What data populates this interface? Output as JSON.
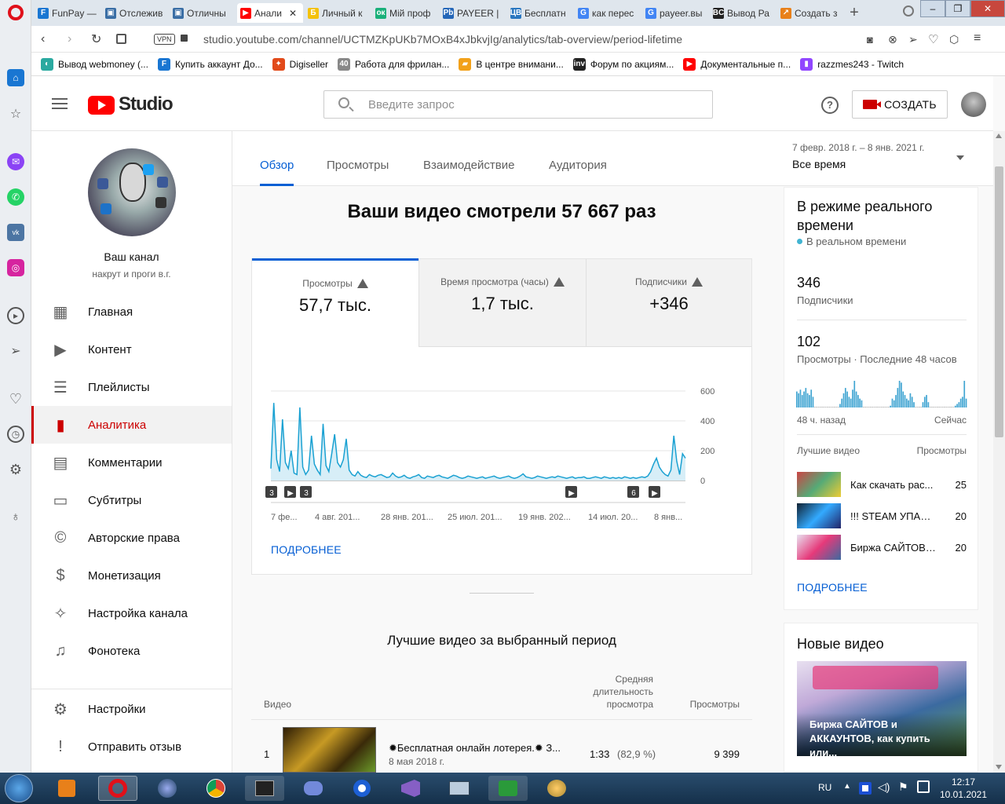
{
  "browser": {
    "tabs": [
      "FunPay —",
      "Отслежив",
      "Отличны",
      "Анали",
      "Личный к",
      "Мій проф",
      "PAYEER |",
      "Бесплатн",
      "как перес",
      "payeer.вы",
      "Вывод Ра",
      "Создать з"
    ],
    "url": "studio.youtube.com/channel/UCTMZKpUKb7MOxB4xJbkvjIg/analytics/tab-overview/period-lifetime",
    "vpn": "VPN",
    "bookmarks": [
      "Вывод webmoney (...",
      "Купить аккаунт До...",
      "Digiseller",
      "Работа для фрилан...",
      "В центре внимани...",
      "Форум по акциям...",
      "Документальные п...",
      "razzmes243 - Twitch"
    ]
  },
  "header": {
    "logo": "Studio",
    "search_placeholder": "Введите запрос",
    "create": "СОЗДАТЬ"
  },
  "channel": {
    "name": "Ваш канал",
    "handle": "накрут и проги в.г."
  },
  "nav": [
    {
      "label": "Главная",
      "icon": "dashboard-icon"
    },
    {
      "label": "Контент",
      "icon": "content-icon"
    },
    {
      "label": "Плейлисты",
      "icon": "playlist-icon"
    },
    {
      "label": "Аналитика",
      "icon": "analytics-icon"
    },
    {
      "label": "Комментарии",
      "icon": "comments-icon"
    },
    {
      "label": "Субтитры",
      "icon": "subtitles-icon"
    },
    {
      "label": "Авторские права",
      "icon": "copyright-icon"
    },
    {
      "label": "Монетизация",
      "icon": "dollar-icon"
    },
    {
      "label": "Настройка канала",
      "icon": "wand-icon"
    },
    {
      "label": "Фонотека",
      "icon": "audio-library-icon"
    }
  ],
  "nav_bottom": [
    {
      "label": "Настройки"
    },
    {
      "label": "Отправить отзыв"
    }
  ],
  "analytics": {
    "tabs": [
      "Обзор",
      "Просмотры",
      "Взаимодействие",
      "Аудитория"
    ],
    "period_range": "7 февр. 2018 г. – 8 янв. 2021 г.",
    "period": "Все время",
    "headline": "Ваши видео смотрели 57 667 раз",
    "metrics": [
      {
        "label": "Просмотры",
        "value": "57,7 тыс."
      },
      {
        "label": "Время просмотра (часы)",
        "value": "1,7 тыс."
      },
      {
        "label": "Подписчики",
        "value": "+346"
      }
    ],
    "more": "ПОДРОБНЕЕ",
    "top_title": "Лучшие видео за выбранный период",
    "table_headers": {
      "video": "Видео",
      "avg": "Средняя длительность просмотра",
      "views": "Просмотры"
    },
    "rows": [
      {
        "rank": "1",
        "title": "✹Бесплатная онлайн лотерея.✹ З...",
        "date": "8 мая 2018 г.",
        "avg": "1:33",
        "pct": "(82,9 %)",
        "views": "9 399"
      }
    ]
  },
  "chart_data": {
    "type": "area",
    "x": [
      "7 фе...",
      "4 авг. 201...",
      "28 янв. 201...",
      "25 июл. 201...",
      "19 янв. 202...",
      "14 июл. 20...",
      "8 янв..."
    ],
    "ylim": [
      0,
      600
    ],
    "yticks": [
      "600",
      "400",
      "200",
      "0"
    ],
    "markers": [
      "3",
      "▶",
      "3",
      "▶",
      "6",
      "▶"
    ],
    "series": [
      {
        "values": [
          80,
          520,
          140,
          60,
          410,
          120,
          80,
          200,
          50,
          40,
          490,
          90,
          40,
          70,
          300,
          110,
          70,
          40,
          380,
          100,
          60,
          180,
          310,
          120,
          90,
          140,
          280,
          70,
          40,
          30,
          60,
          35,
          25,
          20,
          40,
          30,
          25,
          35,
          40,
          30,
          20,
          25,
          50,
          30,
          20,
          25,
          35,
          20,
          15,
          25,
          30,
          40,
          20,
          15,
          30,
          25,
          20,
          30,
          35,
          25,
          20,
          15,
          25,
          35,
          30,
          20,
          15,
          20,
          30,
          25,
          20,
          15,
          20,
          25,
          15,
          20,
          25,
          30,
          20,
          15,
          20,
          25,
          30,
          20,
          15,
          20,
          30,
          45,
          25,
          20,
          15,
          20,
          30,
          25,
          20,
          15,
          20,
          25,
          20,
          30,
          25,
          20,
          15,
          20,
          25,
          15,
          20,
          20,
          25,
          15,
          15,
          20,
          25,
          20,
          15,
          25,
          20,
          15,
          20,
          15,
          20,
          15,
          25,
          20,
          15,
          20,
          15,
          20,
          25,
          20,
          30,
          60,
          110,
          150,
          90,
          60,
          40,
          30,
          70,
          300,
          130,
          40,
          180,
          150
        ]
      }
    ]
  },
  "realtime": {
    "title": "В режиме реального времени",
    "live": "В реальном времени",
    "subs_value": "346",
    "subs_label": "Подписчики",
    "views_value": "102",
    "views_label": "Просмотры · Последние 48 часов",
    "axis_left": "48 ч. назад",
    "axis_right": "Сейчас",
    "top_label": "Лучшие видео",
    "top_views": "Просмотры",
    "videos": [
      {
        "title": "Как скачать рас...",
        "views": "25"
      },
      {
        "title": "!!! STEAM УПАЛ !...",
        "views": "20"
      },
      {
        "title": "Биржа САЙТОВ ...",
        "views": "20"
      }
    ],
    "more": "ПОДРОБНЕЕ",
    "bars": [
      18,
      16,
      20,
      14,
      18,
      22,
      16,
      14,
      20,
      12,
      0,
      0,
      0,
      0,
      0,
      0,
      0,
      0,
      0,
      0,
      0,
      0,
      0,
      0,
      4,
      10,
      16,
      22,
      18,
      12,
      10,
      20,
      30,
      18,
      14,
      10,
      8,
      0,
      0,
      0,
      0,
      0,
      0,
      0,
      0,
      0,
      0,
      0,
      0,
      0,
      0,
      0,
      2,
      10,
      8,
      14,
      22,
      30,
      28,
      18,
      14,
      10,
      8,
      16,
      12,
      6,
      0,
      0,
      0,
      0,
      6,
      12,
      14,
      6,
      0,
      0,
      0,
      0,
      0,
      0,
      0,
      0,
      0,
      0,
      0,
      0,
      0,
      0,
      2,
      4,
      6,
      10,
      12,
      30,
      10
    ]
  },
  "new_videos": {
    "title": "Новые видео",
    "video_title": "Биржа САЙТОВ и АККАУНТОВ, как купить или..."
  },
  "taskbar": {
    "lang": "RU",
    "time": "12:17",
    "date": "10.01.2021"
  }
}
